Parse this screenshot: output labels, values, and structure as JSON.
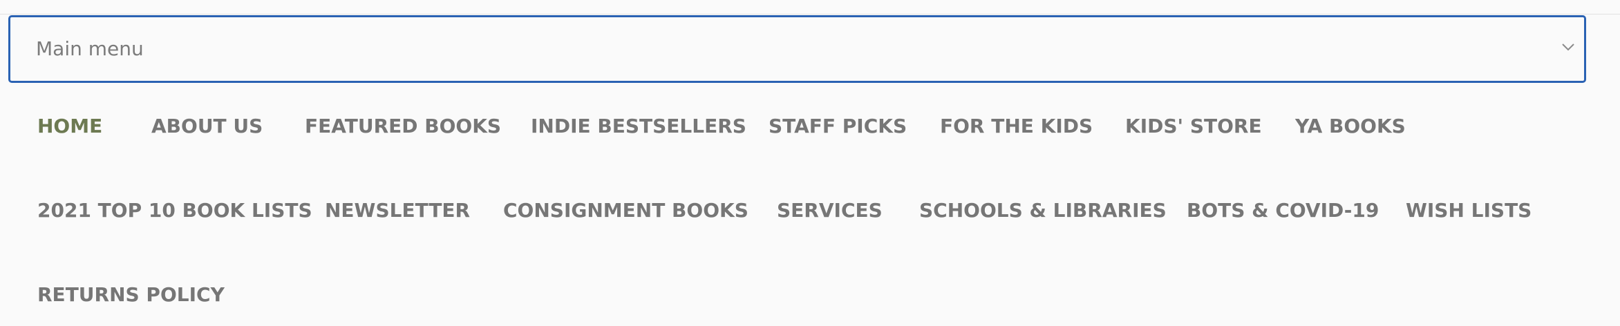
{
  "main_menu": {
    "label": "Main menu",
    "chevron_icon": "chevron-down-icon"
  },
  "nav": {
    "row1": [
      {
        "label": "HOME",
        "active": true
      },
      {
        "label": "ABOUT US"
      },
      {
        "label": "FEATURED BOOKS"
      },
      {
        "label": "INDIE BESTSELLERS"
      },
      {
        "label": "STAFF PICKS"
      },
      {
        "label": "FOR THE KIDS"
      },
      {
        "label": "KIDS' STORE"
      },
      {
        "label": "YA BOOKS"
      }
    ],
    "row2": [
      {
        "label": "2021 TOP 10 BOOK LISTS"
      },
      {
        "label": "NEWSLETTER"
      },
      {
        "label": "CONSIGNMENT BOOKS"
      },
      {
        "label": "SERVICES"
      },
      {
        "label": "SCHOOLS & LIBRARIES"
      },
      {
        "label": "BOTS & COVID-19"
      },
      {
        "label": "WISH LISTS"
      }
    ],
    "row3": [
      {
        "label": "RETURNS POLICY"
      }
    ]
  },
  "colors": {
    "select_border": "#2a62b3",
    "active_link": "#6d7a52",
    "link": "#767676",
    "background": "#fafafa"
  }
}
